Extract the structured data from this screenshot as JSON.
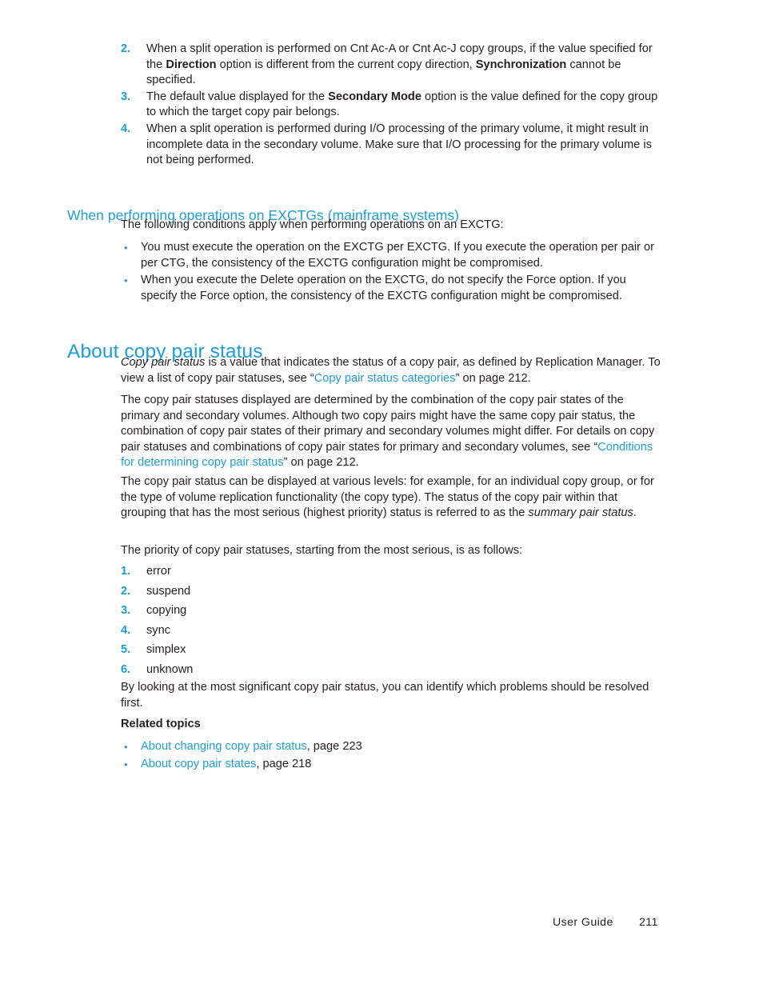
{
  "document": {
    "footer": {
      "label": "User Guide",
      "page_number": "211"
    }
  },
  "top_numbered_list": {
    "items": [
      {
        "marker": "2.",
        "text_part_1": "When a split operation is performed on Cnt Ac-A or Cnt Ac-J copy groups, if the value specified for the ",
        "bold_1": "Direction",
        "text_part_2": " option is different from the current copy direction, ",
        "bold_2": "Synchronization",
        "text_part_3": " cannot be specified."
      },
      {
        "marker": "3.",
        "text_part_1": "The default value displayed for the ",
        "bold_1": "Secondary Mode",
        "text_part_2": " option is the value defined for the copy group to which the target copy pair belongs.",
        "bold_2": "",
        "text_part_3": ""
      },
      {
        "marker": "4.",
        "text_part_1": "When a split operation is performed during I/O processing of the primary volume, it might result in incomplete data in the secondary volume. Make sure that I/O processing for the primary volume is not being performed.",
        "bold_1": "",
        "text_part_2": "",
        "bold_2": "",
        "text_part_3": ""
      }
    ]
  },
  "section_exctg": {
    "heading": "When performing operations on EXCTGs (mainframe systems)",
    "intro": "The following conditions apply when performing operations on an EXCTG:",
    "bullets": [
      "You must execute the operation on the EXCTG per EXCTG. If you execute the operation per pair or per CTG, the consistency of the EXCTG configuration might be compromised.",
      "When you execute the Delete operation on the EXCTG, do not specify the Force option. If you specify the Force option, the consistency of the EXCTG configuration might be compromised."
    ]
  },
  "section_status": {
    "heading": "About copy pair status",
    "p1": {
      "italic_lead": "Copy pair status",
      "text_1": " is a value that indicates the status of a copy pair, as defined by Replication Manager. To view a list of copy pair statuses, see “",
      "link": "Copy pair status categories",
      "text_2": "” on page 212."
    },
    "p2": {
      "text_1": "The copy pair statuses displayed are determined by the combination of the copy pair states of the primary and secondary volumes. Although two copy pairs might have the same copy pair status, the combination of copy pair states of their primary and secondary volumes might differ. For details on copy pair statuses and combinations of copy pair states for primary and secondary volumes, see “",
      "link": "Conditions for determining copy pair status",
      "text_2": "” on page 212."
    },
    "p3": {
      "text_1": "The copy pair status can be displayed at various levels: for example, for an individual copy group, or for the type of volume replication functionality (the copy type). The status of the copy pair within that grouping that has the most serious (highest priority) status is referred to as the ",
      "italic": "summary pair status",
      "text_2": "."
    },
    "p4": "The priority of copy pair statuses, starting from the most serious, is as follows:",
    "priority_list": [
      {
        "marker": "1.",
        "label": "error"
      },
      {
        "marker": "2.",
        "label": "suspend"
      },
      {
        "marker": "3.",
        "label": "copying"
      },
      {
        "marker": "4.",
        "label": "sync"
      },
      {
        "marker": "5.",
        "label": "simplex"
      },
      {
        "marker": "6.",
        "label": "unknown"
      }
    ],
    "p5": "By looking at the most significant copy pair status, you can identify which problems should be resolved first.",
    "related_topics_heading": "Related topics",
    "related_topics": [
      {
        "link": "About changing copy pair status",
        "suffix": ", page 223"
      },
      {
        "link": "About copy pair states",
        "suffix": ", page 218"
      }
    ]
  },
  "colors": {
    "accent_blue": "#1b9dd9",
    "body_text": "#231f20",
    "page_background": "#ffffff"
  }
}
